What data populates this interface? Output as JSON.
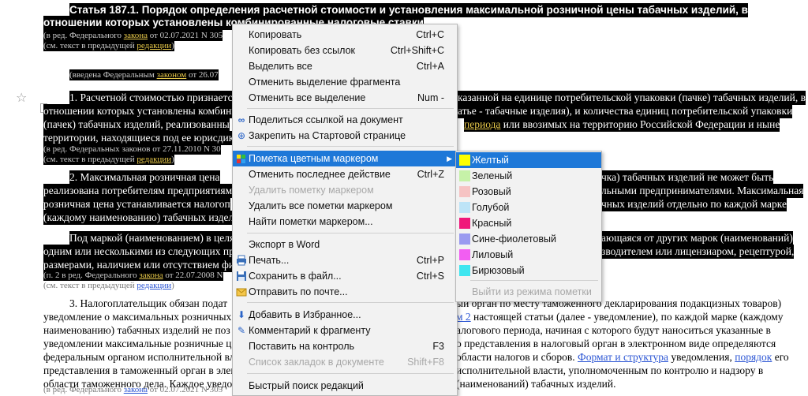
{
  "document": {
    "heading_line1": "Статья 187.1. Порядок определения расчетной стоимости и установления максимальной розничной цены табачных изделий, в",
    "heading_line2": "отношении которых установлены комбинированные налоговые ставки",
    "note1_pre": "(в ред. Федерального ",
    "note1_link": "закона",
    "note1_post": " от 02.07.2021 N 305",
    "note2_pre": "(см. текст в предыдущей ",
    "note2_link": "редакции",
    "note2_post": ")",
    "note3_pre": "(введена Федеральным ",
    "note3_link": "законом",
    "note3_post": " от 26.07",
    "p1_l1_a": "1. Расчетной стоимостью признаетс",
    "p1_l1_b": "казанной на единице потребительской упаковки (пачке) табачных изделий, в",
    "p1_l2_a": "отношении которых установлены комбини",
    "p1_l2_b": "атье - табачные изделия), и количества единиц потребительской упаковки",
    "p1_l3_a": "(пачек) табачных изделий, реализованны",
    "p1_l3_link": "периода",
    "p1_l3_b": " или ввозимых на территорию Российской Федерации и ныне",
    "p1_l4": "территории, находящиеся под ее юрисдик",
    "note4_pre": "(в ред. Федеральных законов от 27.11.2010 N 30",
    "note5_pre": "(см. текст в предыдущей ",
    "note5_link": "редакции",
    "note5_post": ")",
    "p2_l1_a": "2. Максимальная розничная цена",
    "p2_l1_b": "чка) табачных изделий не может быть",
    "p2_l2_a": "реализована потребителям предприятиями",
    "p2_l2_b": "льными предпринимателями. Максимальная",
    "p2_l3_a": "розничная цена устанавливается налогоп",
    "p2_l3_b": "чных изделий отдельно по каждой марке",
    "p2_l4": "(каждому наименованию) табачных издели",
    "p3_l1_a": "Под маркой (наименованием) в целя",
    "p3_l1_b": "ающаяся от других марок (наименований)",
    "p3_l2_a": "одним или несколькими из следующих пр",
    "p3_l2_b": "зводителем или лицензиаром, рецептурой,",
    "p3_l3": "размерами, наличием или отсутствием фил",
    "note6_pre": "(п. 2 в ред. Федерального ",
    "note6_link": "закона",
    "note6_post": " от 22.07.2008 N",
    "note7_pre": "(см. текст в предыдущей ",
    "note7_link": "редакции",
    "note7_post": ")",
    "p4_l1_a": "3. Налогоплательщик обязан подат",
    "p4_l1_b": "ый орган по месту таможенного декларирования подакцизных товаров)",
    "p4_l2_a": "уведомление о максимальных розничных",
    "p4_l2_link": "м 2",
    "p4_l2_b": " настоящей статьи (далее - уведомление), по каждой марке (каждому",
    "p4_l3_a": "наименованию) табачных изделий не поз",
    "p4_l3_b": "алогового периода, начиная с которого будут наноситься указанные в",
    "p4_l4_a": "уведомлении максимальные розничные ц",
    "p4_l4_b": "о представления в налоговый орган в электронном виде определяются",
    "p4_l5_a": "федеральным органом исполнительной вла",
    "p4_l5_b": "области налогов и сборов. ",
    "p4_l5_link1": "Формат и структура",
    "p4_l5_c": " уведомления, ",
    "p4_l5_link2": "порядок",
    "p4_l5_d": " его",
    "p4_l6_a": "представления в таможенный орган в элек",
    "p4_l6_b": "исполнительной власти, уполномоченным по контролю и надзору в",
    "p4_l7_a": "области таможенного дела. Каждое уведо",
    "p4_l7_b": "(наименований) табачных изделий.",
    "note8_pre": "(в ред. Федерального ",
    "note8_link": "закона",
    "note8_post": " от 02.07.2021 N 305"
  },
  "context_menu": {
    "items": [
      {
        "label": "Копировать",
        "shortcut": "Ctrl+C",
        "icon": ""
      },
      {
        "label": "Копировать без ссылок",
        "shortcut": "Ctrl+Shift+C",
        "icon": ""
      },
      {
        "label": "Выделить все",
        "shortcut": "Ctrl+A",
        "icon": ""
      },
      {
        "label": "Отменить выделение фрагмента",
        "shortcut": "",
        "icon": ""
      },
      {
        "label": "Отменить все выделение",
        "shortcut": "Num -",
        "icon": ""
      },
      {
        "label": "Поделиться ссылкой на документ",
        "shortcut": "",
        "icon": "share-link-icon"
      },
      {
        "label": "Закрепить на Стартовой странице",
        "shortcut": "",
        "icon": "pin-icon"
      },
      {
        "label": "Пометка цветным маркером",
        "shortcut": "",
        "icon": "marker-icon"
      },
      {
        "label": "Отменить последнее действие",
        "shortcut": "Ctrl+Z",
        "icon": ""
      },
      {
        "label": "Удалить пометку маркером",
        "shortcut": "",
        "icon": ""
      },
      {
        "label": "Удалить все пометки маркером",
        "shortcut": "",
        "icon": ""
      },
      {
        "label": "Найти пометки маркером...",
        "shortcut": "",
        "icon": ""
      },
      {
        "label": "Экспорт в Word",
        "shortcut": "",
        "icon": ""
      },
      {
        "label": "Печать...",
        "shortcut": "Ctrl+P",
        "icon": "printer-icon"
      },
      {
        "label": "Сохранить в файл...",
        "shortcut": "Ctrl+S",
        "icon": "save-icon"
      },
      {
        "label": "Отправить по почте...",
        "shortcut": "",
        "icon": "mail-icon"
      },
      {
        "label": "Добавить в Избранное...",
        "shortcut": "",
        "icon": "favorites-icon"
      },
      {
        "label": "Комментарий к фрагменту",
        "shortcut": "",
        "icon": "comment-icon"
      },
      {
        "label": "Поставить на контроль",
        "shortcut": "F3",
        "icon": ""
      },
      {
        "label": "Список закладок в документе",
        "shortcut": "Shift+F8",
        "icon": ""
      },
      {
        "label": "Быстрый поиск редакций",
        "shortcut": "",
        "icon": ""
      }
    ]
  },
  "marker_submenu": {
    "items": [
      {
        "label": "Желтый",
        "color": "#ffff00"
      },
      {
        "label": "Зеленый",
        "color": "#c6f2a8"
      },
      {
        "label": "Розовый",
        "color": "#f6c3c3"
      },
      {
        "label": "Голубой",
        "color": "#bde4f7"
      },
      {
        "label": "Красный",
        "color": "#f0187a"
      },
      {
        "label": "Сине-фиолетовый",
        "color": "#9a9af0"
      },
      {
        "label": "Лиловый",
        "color": "#f25ef2"
      },
      {
        "label": "Бирюзовый",
        "color": "#3fe6f0"
      }
    ],
    "exit_label": "Выйти из режима пометки"
  }
}
